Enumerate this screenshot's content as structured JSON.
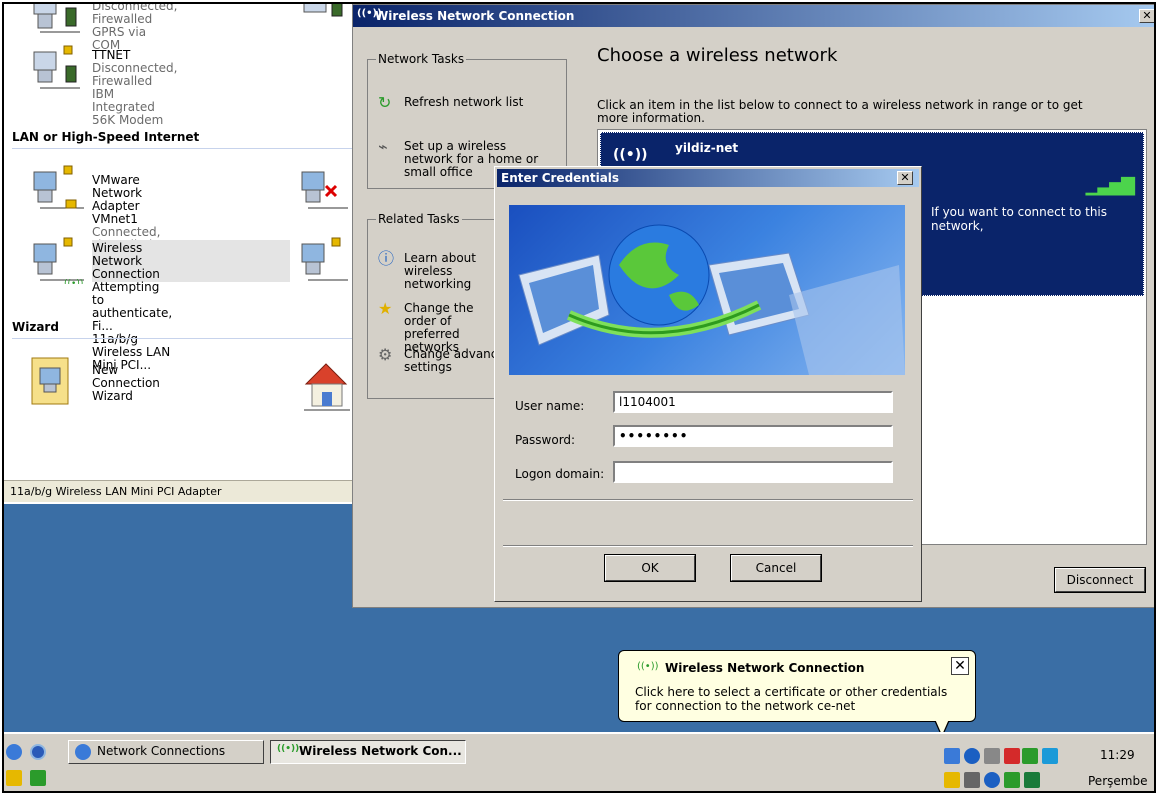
{
  "network_connections": {
    "top_partial": {
      "sub1": "Disconnected, Firewalled",
      "sub2": "GPRS via COM"
    },
    "dialup_items": [
      {
        "name": "TTNET",
        "status": "Disconnected, Firewalled",
        "device": "IBM Integrated 56K Modem"
      }
    ],
    "lan_section_title": "LAN or High-Speed Internet",
    "lan_items": [
      {
        "name": "VMware Network Adapter",
        "name2": "VMnet1",
        "status": "Connected, Firewalled"
      },
      {
        "name": "Wireless Network Connection",
        "status": "Attempting to authenticate, Fi...",
        "device": "11a/b/g Wireless LAN Mini PCI..."
      }
    ],
    "wizard_section_title": "Wizard",
    "wizard_items": [
      {
        "name": "New Connection Wizard"
      }
    ],
    "status_bar": "11a/b/g Wireless LAN Mini PCI Adapter"
  },
  "wireless_window": {
    "title": "Wireless Network Connection",
    "network_tasks_title": "Network Tasks",
    "network_tasks": [
      {
        "label": "Refresh network list",
        "icon": "refresh-icon"
      },
      {
        "label": "Set up a wireless network for a home or small office",
        "icon": "setup-wireless-icon"
      }
    ],
    "related_tasks_title": "Related Tasks",
    "related_tasks": [
      {
        "label": "Learn about wireless networking",
        "icon": "info-icon"
      },
      {
        "label": "Change the order of preferred networks",
        "icon": "star-icon"
      },
      {
        "label": "Change advanced settings",
        "icon": "settings-icon"
      }
    ],
    "heading": "Choose a wireless network",
    "description": "Click an item in the list below to connect to a wireless network in range or to get more information.",
    "network": {
      "name": "yildiz-net",
      "info": "If you want to connect to this network,"
    },
    "disconnect_label": "Disconnect"
  },
  "credentials_dialog": {
    "title": "Enter Credentials",
    "username_label": "User name:",
    "username_value": "l1104001",
    "password_label": "Password:",
    "password_value": "••••••••",
    "domain_label": "Logon domain:",
    "domain_value": "",
    "ok_label": "OK",
    "cancel_label": "Cancel"
  },
  "balloon": {
    "title": "Wireless Network Connection",
    "text": "Click here to select a certificate or other credentials for connection to the network ce-net"
  },
  "taskbar": {
    "buttons": [
      {
        "label": "Network Connections"
      },
      {
        "label": "Wireless Network Con..."
      }
    ],
    "clock_time": "11:29",
    "clock_day": "Perşembe"
  },
  "colors": {
    "titlebar_active": "#0a246a",
    "selection": "#0a246a",
    "desktop": "#3a6ea5",
    "balloon_bg": "#ffffe1",
    "signal": "#4cd44c"
  }
}
